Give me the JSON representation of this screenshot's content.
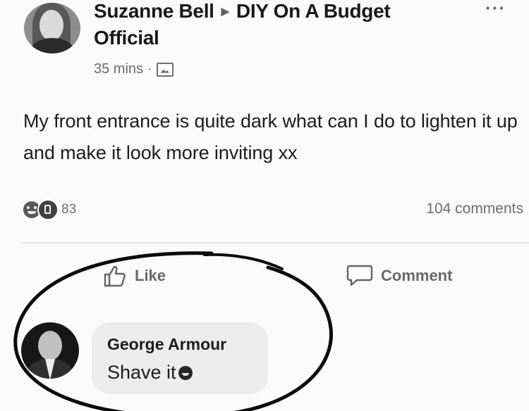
{
  "post": {
    "author": "Suzanne Bell",
    "group_line1": "DIY On A Budget",
    "group_line2": "Official",
    "time": "35 mins",
    "separator": "·",
    "text": "My front entrance is quite dark what can I do to lighten it up and make it look more inviting xx",
    "reaction_count": "83",
    "comments_count": "104 comments",
    "more_label": "···",
    "arrow": "▶"
  },
  "actions": {
    "like_label": "Like",
    "comment_label": "Comment"
  },
  "comment": {
    "author": "George Armour",
    "text": "Shave it"
  },
  "icons": {
    "privacy": "group-privacy-icon",
    "like": "thumbs-up-icon",
    "comment": "speech-bubble-icon",
    "reaction_haha": "haha-emoji-icon",
    "reaction_like": "like-reaction-icon",
    "comment_emoji": "laughing-emoji-icon"
  }
}
